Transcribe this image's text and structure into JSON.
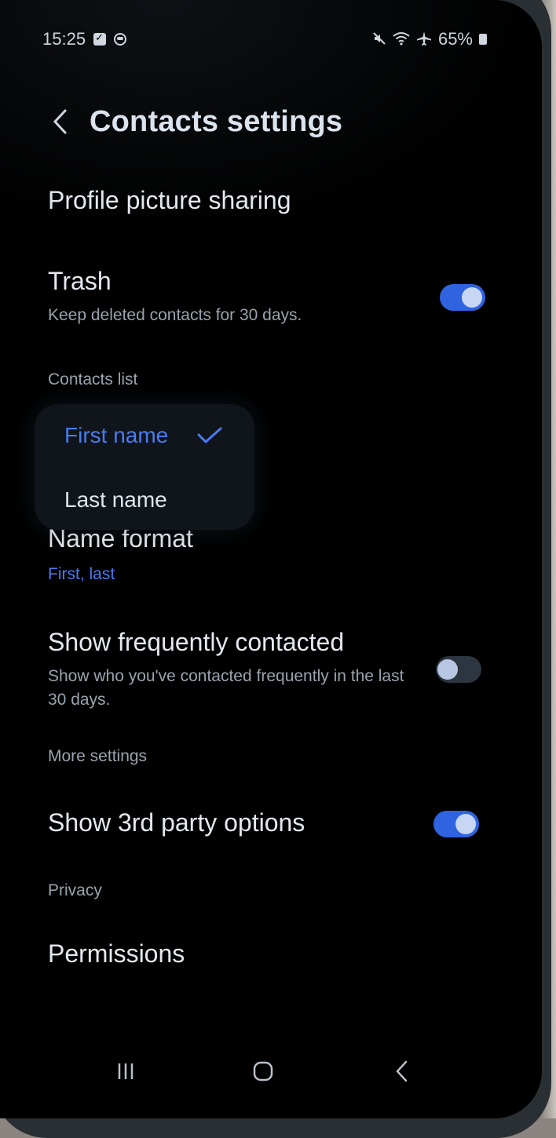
{
  "status_bar": {
    "time": "15:25",
    "battery": "65%",
    "icons": [
      "checkbox-notification-icon",
      "circle-notification-icon",
      "mute-icon",
      "wifi-icon",
      "airplane-icon",
      "battery-icon"
    ]
  },
  "header": {
    "back_icon": "back-chevron-icon",
    "title": "Contacts settings"
  },
  "items": {
    "profile_picture": {
      "title": "Profile picture sharing"
    },
    "trash": {
      "title": "Trash",
      "subtitle": "Keep deleted contacts for 30 days.",
      "enabled": true
    },
    "name_format": {
      "title": "Name format",
      "value": "First, last"
    },
    "frequently_contacted": {
      "title": "Show frequently contacted",
      "subtitle": "Show who you've contacted frequently in the last 30 days.",
      "enabled": false
    },
    "third_party": {
      "title": "Show 3rd party options",
      "enabled": true
    },
    "permissions": {
      "title": "Permissions"
    }
  },
  "sections": {
    "contacts_list": "Contacts list",
    "more_settings": "More settings",
    "privacy": "Privacy"
  },
  "name_format_popup": {
    "options": [
      {
        "label": "First name",
        "selected": true
      },
      {
        "label": "Last name",
        "selected": false
      }
    ]
  },
  "nav_bar": {
    "buttons": [
      "recents-icon",
      "home-icon",
      "back-icon"
    ]
  },
  "colors": {
    "accent": "#2f63e0",
    "accent_text": "#4a7bf0",
    "background": "#000000"
  }
}
